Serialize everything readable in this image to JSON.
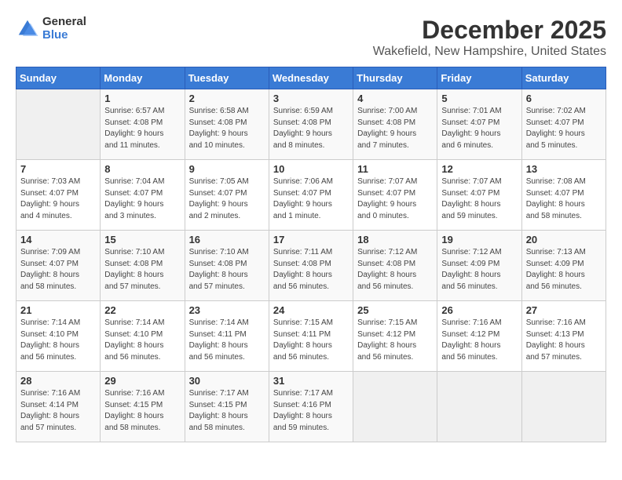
{
  "logo": {
    "general": "General",
    "blue": "Blue"
  },
  "title": "December 2025",
  "location": "Wakefield, New Hampshire, United States",
  "days_of_week": [
    "Sunday",
    "Monday",
    "Tuesday",
    "Wednesday",
    "Thursday",
    "Friday",
    "Saturday"
  ],
  "weeks": [
    [
      {
        "day": "",
        "info": ""
      },
      {
        "day": "1",
        "info": "Sunrise: 6:57 AM\nSunset: 4:08 PM\nDaylight: 9 hours\nand 11 minutes."
      },
      {
        "day": "2",
        "info": "Sunrise: 6:58 AM\nSunset: 4:08 PM\nDaylight: 9 hours\nand 10 minutes."
      },
      {
        "day": "3",
        "info": "Sunrise: 6:59 AM\nSunset: 4:08 PM\nDaylight: 9 hours\nand 8 minutes."
      },
      {
        "day": "4",
        "info": "Sunrise: 7:00 AM\nSunset: 4:08 PM\nDaylight: 9 hours\nand 7 minutes."
      },
      {
        "day": "5",
        "info": "Sunrise: 7:01 AM\nSunset: 4:07 PM\nDaylight: 9 hours\nand 6 minutes."
      },
      {
        "day": "6",
        "info": "Sunrise: 7:02 AM\nSunset: 4:07 PM\nDaylight: 9 hours\nand 5 minutes."
      }
    ],
    [
      {
        "day": "7",
        "info": "Sunrise: 7:03 AM\nSunset: 4:07 PM\nDaylight: 9 hours\nand 4 minutes."
      },
      {
        "day": "8",
        "info": "Sunrise: 7:04 AM\nSunset: 4:07 PM\nDaylight: 9 hours\nand 3 minutes."
      },
      {
        "day": "9",
        "info": "Sunrise: 7:05 AM\nSunset: 4:07 PM\nDaylight: 9 hours\nand 2 minutes."
      },
      {
        "day": "10",
        "info": "Sunrise: 7:06 AM\nSunset: 4:07 PM\nDaylight: 9 hours\nand 1 minute."
      },
      {
        "day": "11",
        "info": "Sunrise: 7:07 AM\nSunset: 4:07 PM\nDaylight: 9 hours\nand 0 minutes."
      },
      {
        "day": "12",
        "info": "Sunrise: 7:07 AM\nSunset: 4:07 PM\nDaylight: 8 hours\nand 59 minutes."
      },
      {
        "day": "13",
        "info": "Sunrise: 7:08 AM\nSunset: 4:07 PM\nDaylight: 8 hours\nand 58 minutes."
      }
    ],
    [
      {
        "day": "14",
        "info": "Sunrise: 7:09 AM\nSunset: 4:07 PM\nDaylight: 8 hours\nand 58 minutes."
      },
      {
        "day": "15",
        "info": "Sunrise: 7:10 AM\nSunset: 4:08 PM\nDaylight: 8 hours\nand 57 minutes."
      },
      {
        "day": "16",
        "info": "Sunrise: 7:10 AM\nSunset: 4:08 PM\nDaylight: 8 hours\nand 57 minutes."
      },
      {
        "day": "17",
        "info": "Sunrise: 7:11 AM\nSunset: 4:08 PM\nDaylight: 8 hours\nand 56 minutes."
      },
      {
        "day": "18",
        "info": "Sunrise: 7:12 AM\nSunset: 4:08 PM\nDaylight: 8 hours\nand 56 minutes."
      },
      {
        "day": "19",
        "info": "Sunrise: 7:12 AM\nSunset: 4:09 PM\nDaylight: 8 hours\nand 56 minutes."
      },
      {
        "day": "20",
        "info": "Sunrise: 7:13 AM\nSunset: 4:09 PM\nDaylight: 8 hours\nand 56 minutes."
      }
    ],
    [
      {
        "day": "21",
        "info": "Sunrise: 7:14 AM\nSunset: 4:10 PM\nDaylight: 8 hours\nand 56 minutes."
      },
      {
        "day": "22",
        "info": "Sunrise: 7:14 AM\nSunset: 4:10 PM\nDaylight: 8 hours\nand 56 minutes."
      },
      {
        "day": "23",
        "info": "Sunrise: 7:14 AM\nSunset: 4:11 PM\nDaylight: 8 hours\nand 56 minutes."
      },
      {
        "day": "24",
        "info": "Sunrise: 7:15 AM\nSunset: 4:11 PM\nDaylight: 8 hours\nand 56 minutes."
      },
      {
        "day": "25",
        "info": "Sunrise: 7:15 AM\nSunset: 4:12 PM\nDaylight: 8 hours\nand 56 minutes."
      },
      {
        "day": "26",
        "info": "Sunrise: 7:16 AM\nSunset: 4:12 PM\nDaylight: 8 hours\nand 56 minutes."
      },
      {
        "day": "27",
        "info": "Sunrise: 7:16 AM\nSunset: 4:13 PM\nDaylight: 8 hours\nand 57 minutes."
      }
    ],
    [
      {
        "day": "28",
        "info": "Sunrise: 7:16 AM\nSunset: 4:14 PM\nDaylight: 8 hours\nand 57 minutes."
      },
      {
        "day": "29",
        "info": "Sunrise: 7:16 AM\nSunset: 4:15 PM\nDaylight: 8 hours\nand 58 minutes."
      },
      {
        "day": "30",
        "info": "Sunrise: 7:17 AM\nSunset: 4:15 PM\nDaylight: 8 hours\nand 58 minutes."
      },
      {
        "day": "31",
        "info": "Sunrise: 7:17 AM\nSunset: 4:16 PM\nDaylight: 8 hours\nand 59 minutes."
      },
      {
        "day": "",
        "info": ""
      },
      {
        "day": "",
        "info": ""
      },
      {
        "day": "",
        "info": ""
      }
    ]
  ]
}
